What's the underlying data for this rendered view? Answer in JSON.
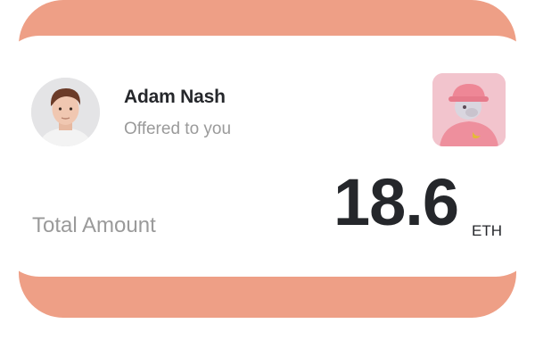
{
  "offer": {
    "name": "Adam Nash",
    "subtitle": "Offered to you",
    "total_label": "Total Amount",
    "amount": "18.6",
    "unit": "ETH"
  },
  "icons": {
    "avatar": "person-portrait",
    "nft": "pink-ape-nft-thumbnail"
  },
  "colors": {
    "accent": "#ee9f86",
    "text_dark": "#25272b",
    "text_muted": "#9a9a9a",
    "nft_bg": "#f1c6cf"
  }
}
